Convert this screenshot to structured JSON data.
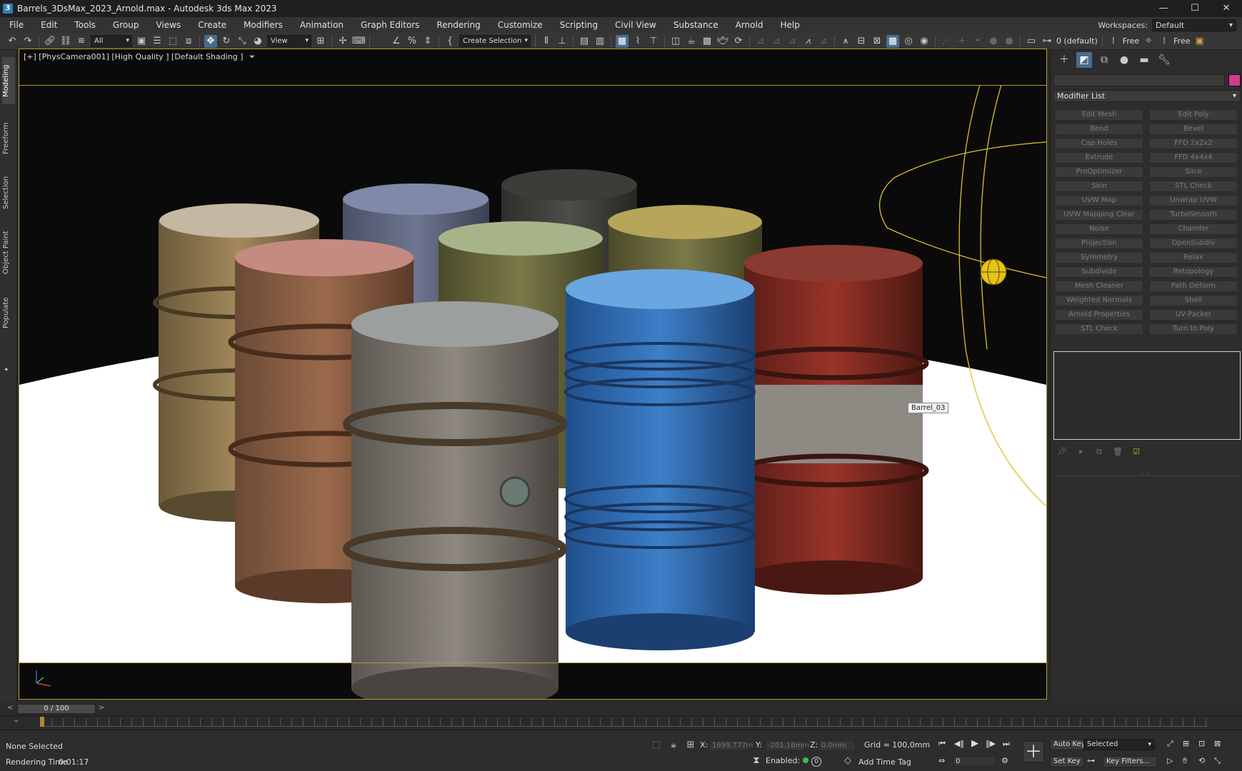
{
  "window": {
    "title": "Barrels_3DsMax_2023_Arnold.max - Autodesk 3ds Max 2023",
    "app_icon": "3",
    "minimize": "—",
    "maximize": "☐",
    "close": "✕"
  },
  "menu": [
    "File",
    "Edit",
    "Tools",
    "Group",
    "Views",
    "Create",
    "Modifiers",
    "Animation",
    "Graph Editors",
    "Rendering",
    "Customize",
    "Scripting",
    "Civil View",
    "Substance",
    "Arnold",
    "Help"
  ],
  "workspaces": {
    "label": "Workspaces:",
    "value": "Default"
  },
  "toolbar": {
    "filter_value": "All",
    "reference_coord": "View",
    "selection_set": "Create Selection Se",
    "layer": "0 (default)",
    "free1": "Free",
    "free2": "Free"
  },
  "left_tabs": [
    "Modeling",
    "Freeform",
    "Selection",
    "Object Paint",
    "Populate"
  ],
  "viewport": {
    "label": "[+] [PhysCamera001] [High Quality ] [Default Shading ]",
    "tooltip": "Barrel_03"
  },
  "command_panel": {
    "modifier_list": "Modifier List",
    "modifiers": [
      [
        "Edit Mesh",
        "Edit Poly"
      ],
      [
        "Bend",
        "Bevel"
      ],
      [
        "Cap Holes",
        "FFD 2x2x2"
      ],
      [
        "Extrude",
        "FFD 4x4x4"
      ],
      [
        "ProOptimizer",
        "Slice"
      ],
      [
        "Skin",
        "STL Check"
      ],
      [
        "UVW Map",
        "Unwrap UVW"
      ],
      [
        "UVW Mapping Clear",
        "TurboSmooth"
      ],
      [
        "Noise",
        "Chamfer"
      ],
      [
        "Projection",
        "OpenSubdiv"
      ],
      [
        "Symmetry",
        "Relax"
      ],
      [
        "Subdivide",
        "Retopology"
      ],
      [
        "Mesh Cleaner",
        "Path Deform"
      ],
      [
        "Weighted Normals",
        "Shell"
      ],
      [
        "Arnold Properties",
        "UV-Packer"
      ],
      [
        "STL Check",
        "Turn to Poly"
      ]
    ]
  },
  "timeline": {
    "frame": "0 / 100"
  },
  "status": {
    "selection": "None Selected",
    "render_time_label": "Rendering Time",
    "render_time": "0:01:17",
    "x_label": "X:",
    "x_value": "1699,777m",
    "y_label": "Y:",
    "y_value": "-201,16mm",
    "z_label": "Z:",
    "z_value": "0,0mm",
    "grid": "Grid = 100,0mm",
    "enabled": "Enabled:",
    "enabled_count": "0",
    "add_time_tag": "Add Time Tag",
    "frame_field": "0",
    "auto_key": "Auto Key",
    "set_key": "Set Key",
    "key_mode": "Selected",
    "key_filters": "Key Filters..."
  },
  "colors": {
    "accent": "#4a6c8c",
    "object_color": "#d23b92",
    "viewport_border": "#b79b2e",
    "ground": "#ffffff",
    "camera_lines": "#d9c12a"
  }
}
